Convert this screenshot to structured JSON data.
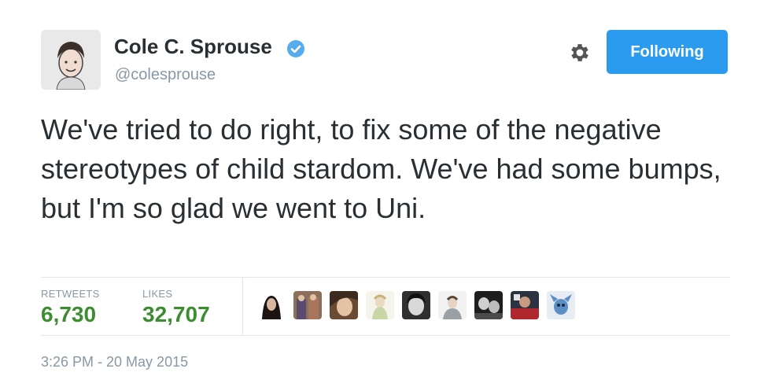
{
  "author": {
    "name": "Cole C. Sprouse",
    "handle": "@colesprouse",
    "verified": true
  },
  "header": {
    "follow_label": "Following"
  },
  "tweet": {
    "text": "We've tried to do right, to fix some of the negative stereotypes of child stardom. We've had some bumps, but I'm so glad we went to Uni."
  },
  "stats": {
    "retweets_label": "RETWEETS",
    "retweets_value": "6,730",
    "likes_label": "LIKES",
    "likes_value": "32,707"
  },
  "likers": [
    {
      "name": "liker-avatar-1"
    },
    {
      "name": "liker-avatar-2"
    },
    {
      "name": "liker-avatar-3"
    },
    {
      "name": "liker-avatar-4"
    },
    {
      "name": "liker-avatar-5"
    },
    {
      "name": "liker-avatar-6"
    },
    {
      "name": "liker-avatar-7"
    },
    {
      "name": "liker-avatar-8"
    },
    {
      "name": "liker-avatar-9"
    }
  ],
  "timestamp": "3:26 PM - 20 May 2015",
  "colors": {
    "follow_button": "#2b9bf0",
    "stat_value": "#3c8d2f",
    "muted": "#8899a6",
    "verified_badge": "#55acee",
    "text": "#292f33"
  }
}
